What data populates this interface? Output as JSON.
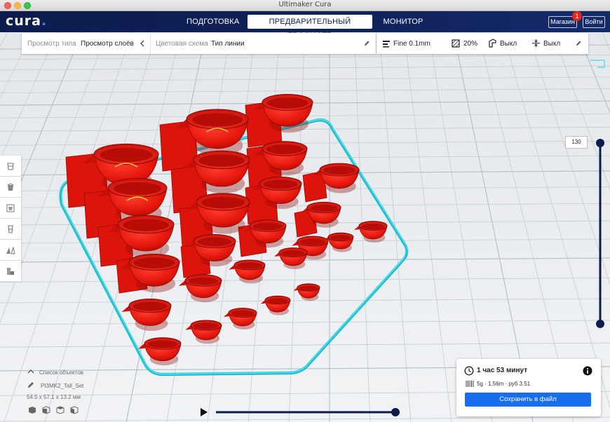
{
  "window": {
    "title": "Ultimaker Cura"
  },
  "header": {
    "logo": "cura",
    "logo_dot": ".",
    "tabs": [
      {
        "label": "ПОДГОТОВКА"
      },
      {
        "label": "ПРЕДВАРИТЕЛЬНЫЙ ПРОСМОТР"
      },
      {
        "label": "МОНИТОР"
      }
    ],
    "marketplace_label": "Магазин",
    "marketplace_badge": "1",
    "signin_label": "Войти"
  },
  "view_bar": {
    "view_type_label": "Просмотр типа",
    "view_type_value": "Просмотр слоёв",
    "color_scheme_label": "Цветовая схема",
    "color_scheme_value": "Тип линии"
  },
  "print_settings": {
    "profile": "Fine 0.1mm",
    "infill": "20%",
    "support": "Выкл",
    "adhesion": "Выкл"
  },
  "layer_slider": {
    "current_layer": "130"
  },
  "object_list": {
    "header": "Список объектов",
    "object_name": "PI3MK2_Tall_Set",
    "dimensions": "54.5 x 57.1 x 13.2 мм"
  },
  "print_info": {
    "time": "1 час 53 минут",
    "material": "5g · 1.56m · руб 3.51",
    "save_label": "Сохранить в файл"
  },
  "colors": {
    "accent": "#196ef0",
    "header_bg": "#10225a",
    "model_red": "#e61a0f",
    "skirt_cyan": "#3fd8e8",
    "grid_line": "#c9ced4"
  }
}
